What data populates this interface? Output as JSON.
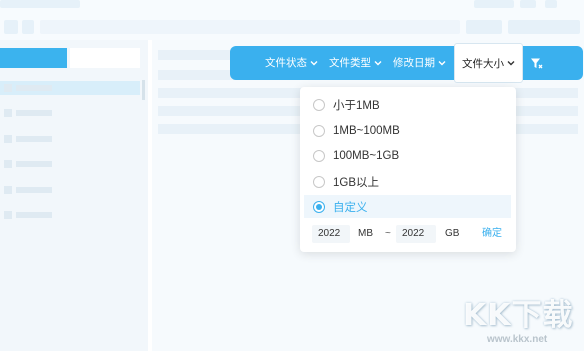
{
  "toolbar": {
    "file_status": "文件状态",
    "file_type": "文件类型",
    "modified_date": "修改日期",
    "file_size": "文件大小",
    "chevron": "⌄",
    "filter_icon": "filter-icon"
  },
  "size_dropdown": {
    "options": [
      {
        "label": "小于1MB",
        "selected": false
      },
      {
        "label": "1MB~100MB",
        "selected": false
      },
      {
        "label": "100MB~1GB",
        "selected": false
      },
      {
        "label": "1GB以上",
        "selected": false
      },
      {
        "label": "自定义",
        "selected": true
      }
    ],
    "custom": {
      "min_value": "2022",
      "min_unit": "MB",
      "separator": "~",
      "max_value": "2022",
      "max_unit": "GB",
      "confirm_label": "确定"
    }
  },
  "watermark": {
    "logo_text": "KK下载",
    "url": "www.kkx.net"
  },
  "colors": {
    "accent": "#3ab0ee",
    "toolbar_bg": "#3ab0ee",
    "selected_bg": "#eef6fc"
  }
}
